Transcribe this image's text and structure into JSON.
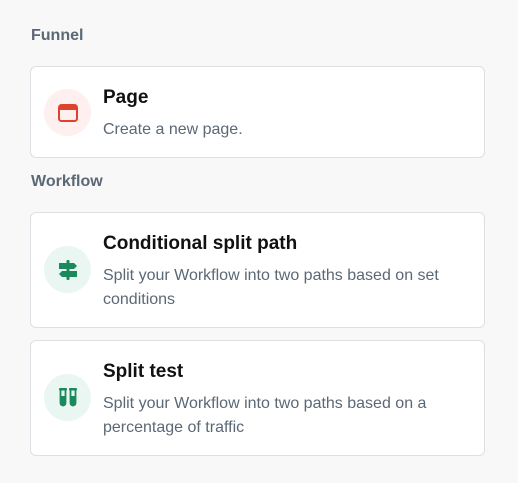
{
  "sections": [
    {
      "label": "Funnel",
      "items": [
        {
          "title": "Page",
          "description": "Create a new page.",
          "icon": "browser-window-icon",
          "icon_color": "#e0412f"
        }
      ]
    },
    {
      "label": "Workflow",
      "items": [
        {
          "title": "Conditional split path",
          "description": "Split your Workflow into two paths based on set conditions",
          "icon": "signpost-icon",
          "icon_color": "#1a8a5c"
        },
        {
          "title": "Split test",
          "description": "Split your Workflow into two paths based on a percentage of traffic",
          "icon": "test-tubes-icon",
          "icon_color": "#1a8a5c"
        }
      ]
    }
  ]
}
